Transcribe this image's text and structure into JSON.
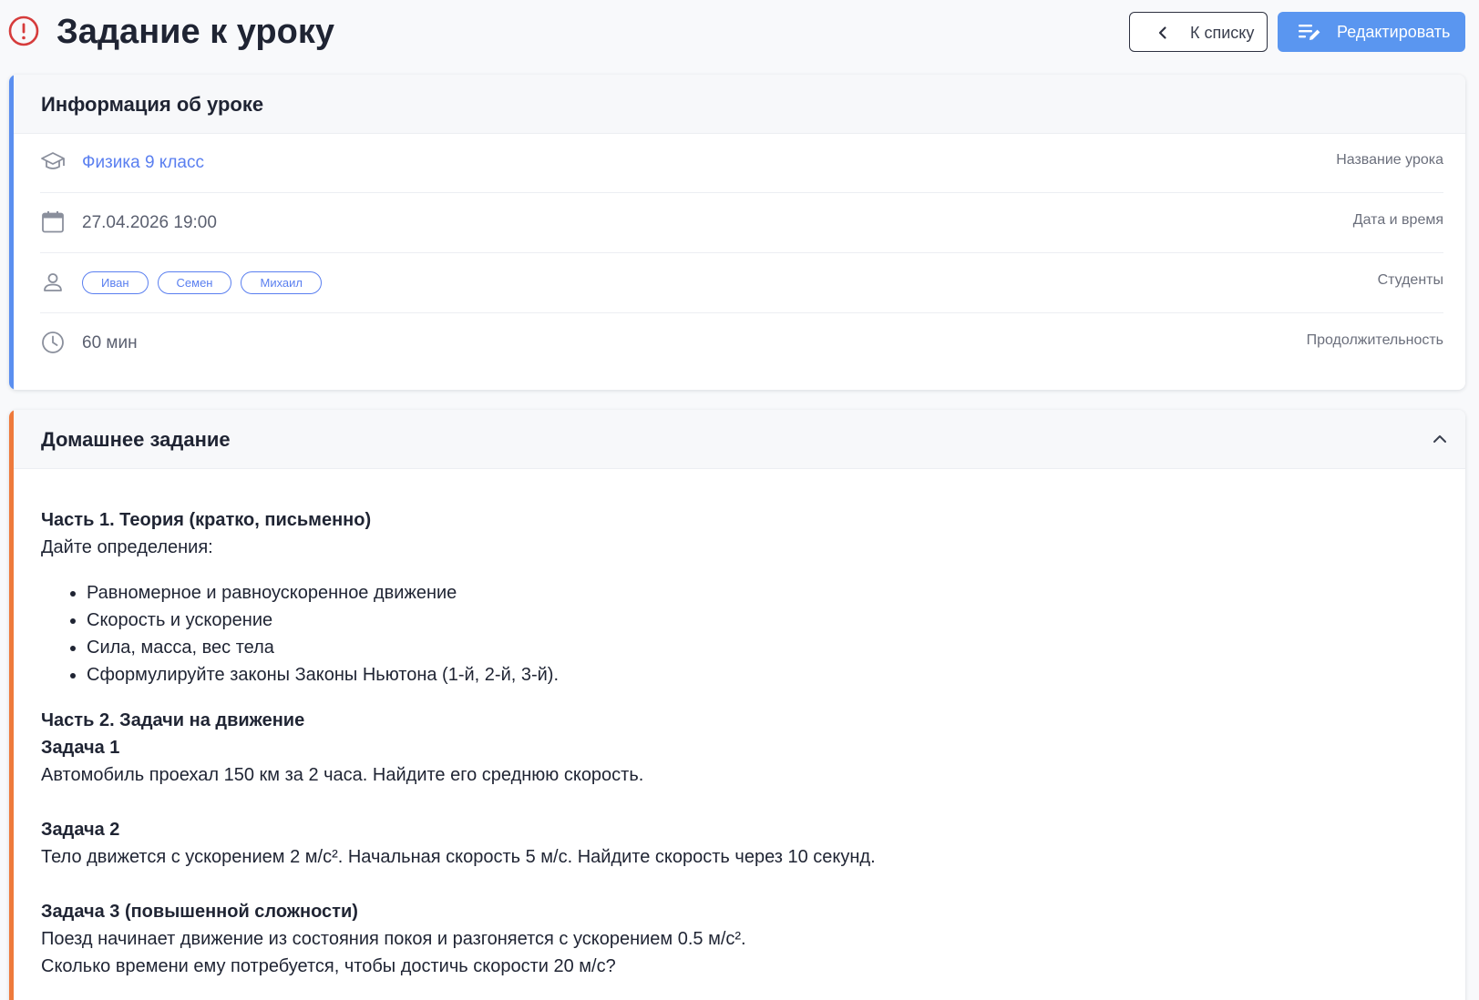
{
  "header": {
    "title": "Задание к уроку",
    "back_label": "К списку",
    "edit_label": "Редактировать"
  },
  "colors": {
    "accent_blue": "#5a96f0",
    "link_blue": "#5a7ff0",
    "info_accent": "#5b8ff0",
    "homework_accent": "#ee7a3c",
    "alert_red": "#d63c3c"
  },
  "info": {
    "title": "Информация об уроке",
    "rows": [
      {
        "icon": "graduation-cap-icon",
        "value": "Физика 9 класс",
        "label": "Название урока"
      },
      {
        "icon": "calendar-icon",
        "value": "27.04.2026 19:00",
        "label": "Дата и время"
      },
      {
        "icon": "person-icon",
        "label": "Студенты",
        "students": [
          "Иван",
          "Семен",
          "Михаил"
        ]
      },
      {
        "icon": "clock-icon",
        "value": "60 мин",
        "label": "Продолжительность"
      }
    ]
  },
  "homework": {
    "title": "Домашнее задание",
    "part1_title": "Часть 1. Теория (кратко, письменно)",
    "part1_intro": "Дайте определения:",
    "part1_items": [
      "Равномерное и равноускоренное движение",
      "Скорость и ускорение",
      "Сила, масса, вес тела",
      "Сформулируйте законы Законы Ньютона (1-й, 2-й, 3-й)."
    ],
    "part2_title": "Часть 2. Задачи на движение",
    "task1_title": "Задача 1",
    "task1_text": "Автомобиль проехал 150 км за 2 часа. Найдите его среднюю скорость.",
    "task2_title": "Задача 2",
    "task2_text": "Тело движется с ускорением 2 м/с². Начальная скорость 5 м/с. Найдите скорость через 10 секунд.",
    "task3_title": "Задача 3 (повышенной сложности)",
    "task3_text_1": "Поезд начинает движение из состояния покоя и разгоняется с ускорением 0.5 м/с².",
    "task3_text_2": "Сколько времени ему потребуется, чтобы достичь скорости 20 м/с?"
  }
}
